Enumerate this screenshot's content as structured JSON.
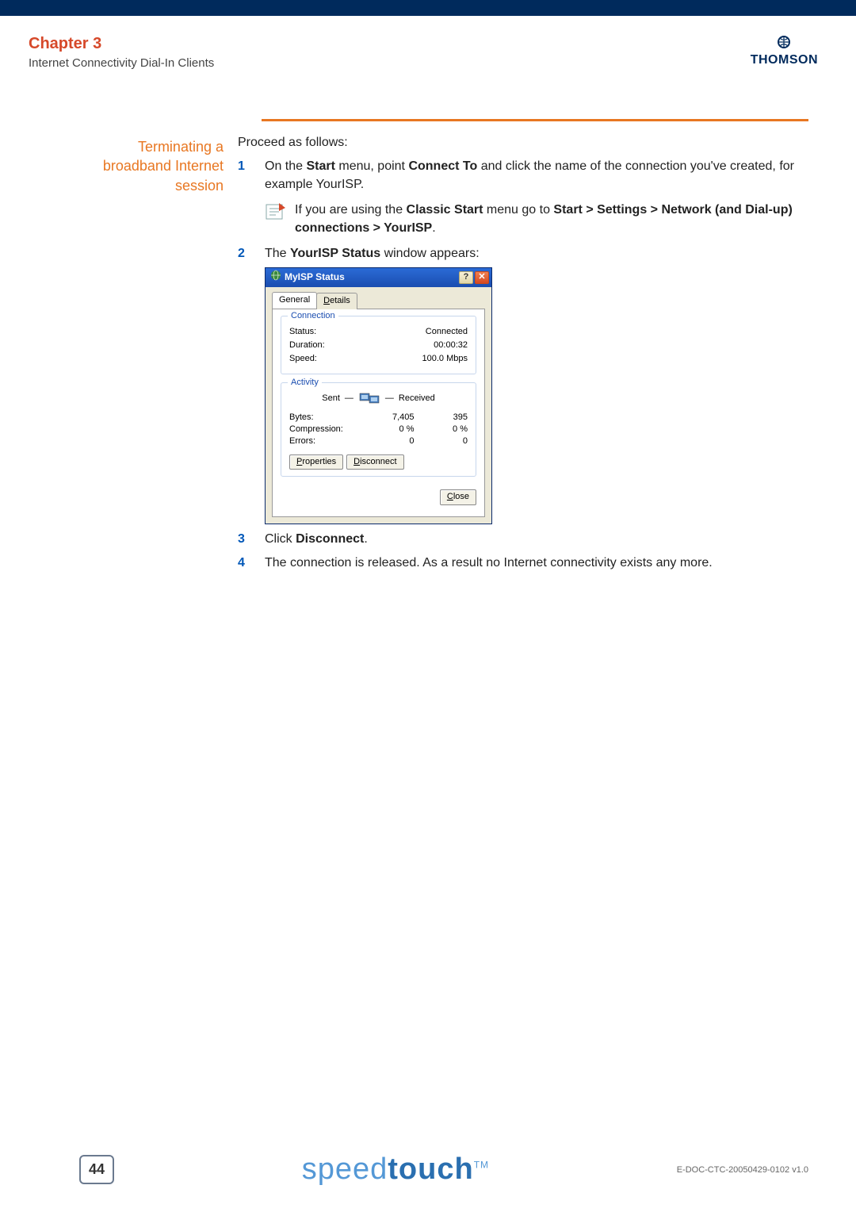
{
  "header": {
    "chapter": "Chapter 3",
    "subtitle": "Internet Connectivity Dial-In Clients",
    "brand": "THOMSON"
  },
  "section_title_line1": "Terminating a",
  "section_title_line2": "broadband Internet",
  "section_title_line3": "session",
  "intro": "Proceed as follows:",
  "steps": {
    "s1_num": "1",
    "s1_pre": "On the ",
    "s1_b1": "Start",
    "s1_mid1": " menu, point ",
    "s1_b2": "Connect To",
    "s1_mid2": " and click the name of the connection you've created, for example YourISP.",
    "note_pre": "If you are using the ",
    "note_b1": "Classic Start",
    "note_mid": " menu go to ",
    "note_b2": "Start > Settings > Network (and Dial-up) connections > YourISP",
    "note_end": ".",
    "s2_num": "2",
    "s2_pre": "The ",
    "s2_b1": "YourISP Status",
    "s2_end": " window appears:",
    "s3_num": "3",
    "s3_pre": "Click ",
    "s3_b1": "Disconnect",
    "s3_end": ".",
    "s4_num": "4",
    "s4_text": "The connection is released. As a result no Internet connectivity exists any more."
  },
  "dialog": {
    "title": "MyISP Status",
    "tab_general": "General",
    "tab_details": "Details",
    "group_conn": "Connection",
    "status_label": "Status:",
    "status_value": "Connected",
    "duration_label": "Duration:",
    "duration_value": "00:00:32",
    "speed_label": "Speed:",
    "speed_value": "100.0 Mbps",
    "group_activity": "Activity",
    "sent": "Sent",
    "received": "Received",
    "bytes_label": "Bytes:",
    "bytes_sent": "7,405",
    "bytes_recv": "395",
    "comp_label": "Compression:",
    "comp_sent": "0 %",
    "comp_recv": "0 %",
    "err_label": "Errors:",
    "err_sent": "0",
    "err_recv": "0",
    "btn_props": "Properties",
    "btn_disc": "Disconnect",
    "btn_close": "Close",
    "help": "?",
    "x": "✕"
  },
  "footer": {
    "page": "44",
    "brand_prefix": "speed",
    "brand_suffix": "touch",
    "brand_tm": "TM",
    "doc_id": "E-DOC-CTC-20050429-0102 v1.0"
  }
}
